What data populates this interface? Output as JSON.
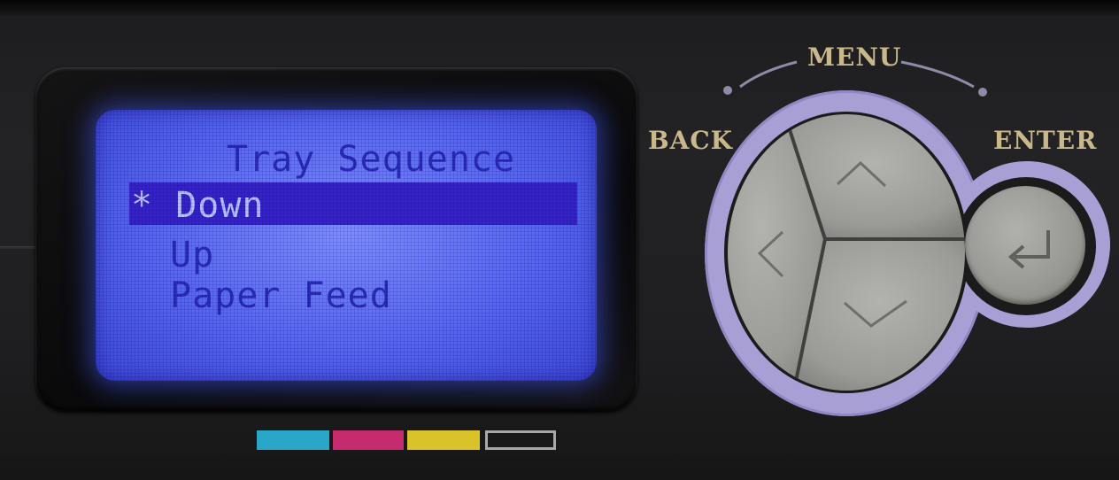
{
  "display": {
    "title": "Tray Sequence",
    "selected_marker": "*",
    "items": [
      "Down",
      "Up",
      "Paper Feed"
    ]
  },
  "labels": {
    "menu": "MENU",
    "back": "BACK",
    "enter": "ENTER"
  },
  "buttons": {
    "up": "chevron-up-icon",
    "left": "chevron-left-icon",
    "down": "chevron-down-icon",
    "enter": "enter-return-icon"
  },
  "colors": {
    "lcd_background": "#6070f5",
    "lcd_text": "#2a2ab8",
    "lcd_highlight": "#3522c9",
    "ring": "#a8a0d4",
    "button": "#9c9d98",
    "label": "#c9b98a"
  },
  "ink_indicators": [
    {
      "name": "cyan",
      "color": "#2aa6c8"
    },
    {
      "name": "magenta",
      "color": "#c42a6c"
    },
    {
      "name": "yellow",
      "color": "#d9c22a"
    },
    {
      "name": "black",
      "color": "#a8a8a8"
    }
  ]
}
